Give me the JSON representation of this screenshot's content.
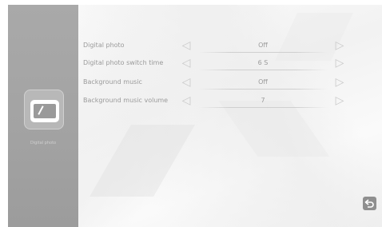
{
  "sidebar": {
    "items": [
      {
        "label": "Digital photo",
        "icon": "photo-frame-icon"
      }
    ]
  },
  "settings": [
    {
      "label": "Digital photo",
      "value": "Off"
    },
    {
      "label": "Digital photo switch time",
      "value": "6 S"
    },
    {
      "label": "Background music",
      "value": "Off"
    },
    {
      "label": "Background music volume",
      "value": "7"
    }
  ],
  "controls": {
    "prev_icon": "arrow-left-icon",
    "next_icon": "arrow-right-icon",
    "back_icon": "back-icon"
  },
  "colors": {
    "sidebar": "#a6a6a6",
    "text": "#9a9a9a",
    "arrow": "#c9c9c9",
    "back_button": "#8f8f8f"
  }
}
